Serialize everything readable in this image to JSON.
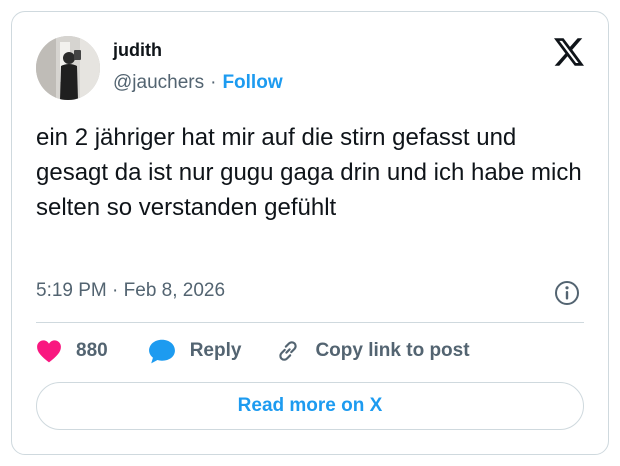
{
  "author": {
    "name": "judith",
    "handle": "@jauchers",
    "separator": "·",
    "follow_label": "Follow"
  },
  "tweet": {
    "text": "ein 2 jähriger hat mir auf die stirn gefasst und gesagt da ist nur gugu gaga drin und ich habe mich selten so verstanden gefühlt",
    "timestamp": "5:19 PM · Feb 8, 2026"
  },
  "actions": {
    "like_count": "880",
    "reply_label": "Reply",
    "copy_link_label": "Copy link to post"
  },
  "read_more_label": "Read more on X",
  "icons": {
    "brand": "x-logo-icon",
    "info": "info-icon",
    "like": "heart-icon",
    "reply": "speech-bubble-icon",
    "copy": "link-icon"
  },
  "colors": {
    "accent": "#1d9bf0",
    "like": "#f91880",
    "text": "#0f1419",
    "muted": "#536471",
    "border": "#cfd9de"
  }
}
